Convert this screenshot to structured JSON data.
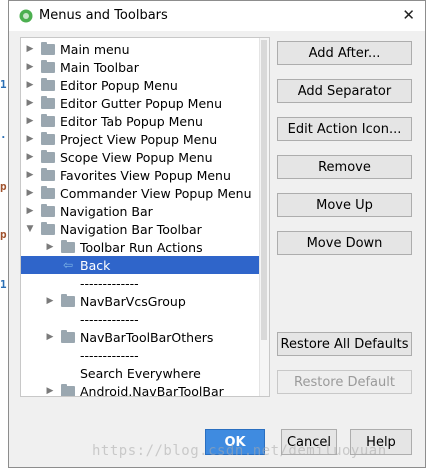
{
  "window": {
    "title": "Menus and Toolbars",
    "close_glyph": "✕"
  },
  "tree": {
    "rows": [
      {
        "label": "Main menu",
        "kind": "folder",
        "arrow": "▶",
        "level": 0
      },
      {
        "label": "Main Toolbar",
        "kind": "folder",
        "arrow": "▶",
        "level": 0
      },
      {
        "label": "Editor Popup Menu",
        "kind": "folder",
        "arrow": "▶",
        "level": 0
      },
      {
        "label": "Editor Gutter Popup Menu",
        "kind": "folder",
        "arrow": "▶",
        "level": 0
      },
      {
        "label": "Editor Tab Popup Menu",
        "kind": "folder",
        "arrow": "▶",
        "level": 0
      },
      {
        "label": "Project View Popup Menu",
        "kind": "folder",
        "arrow": "▶",
        "level": 0
      },
      {
        "label": "Scope View Popup Menu",
        "kind": "folder",
        "arrow": "▶",
        "level": 0
      },
      {
        "label": "Favorites View Popup Menu",
        "kind": "folder",
        "arrow": "▶",
        "level": 0
      },
      {
        "label": "Commander View Popup Menu",
        "kind": "folder",
        "arrow": "▶",
        "level": 0
      },
      {
        "label": "Navigation Bar",
        "kind": "folder",
        "arrow": "▶",
        "level": 0
      },
      {
        "label": "Navigation Bar Toolbar",
        "kind": "folder",
        "arrow": "▼",
        "level": 0
      },
      {
        "label": "Toolbar Run Actions",
        "kind": "folder",
        "arrow": "▶",
        "level": 1
      },
      {
        "label": "Back",
        "kind": "action",
        "arrow": "",
        "level": 1,
        "selected": true
      },
      {
        "label": "-------------",
        "kind": "separator",
        "arrow": "",
        "level": 1
      },
      {
        "label": "NavBarVcsGroup",
        "kind": "folder",
        "arrow": "▶",
        "level": 1
      },
      {
        "label": "-------------",
        "kind": "separator",
        "arrow": "",
        "level": 1
      },
      {
        "label": "NavBarToolBarOthers",
        "kind": "folder",
        "arrow": "▶",
        "level": 1
      },
      {
        "label": "-------------",
        "kind": "separator",
        "arrow": "",
        "level": 1
      },
      {
        "label": "Search Everywhere",
        "kind": "action",
        "arrow": "",
        "level": 1
      },
      {
        "label": "Android.NavBarToolBar",
        "kind": "folder",
        "arrow": "▶",
        "level": 1
      }
    ]
  },
  "buttons": {
    "add_after": "Add After...",
    "add_separator": "Add Separator",
    "edit_action_icon": "Edit Action Icon...",
    "remove": "Remove",
    "move_up": "Move Up",
    "move_down": "Move Down",
    "restore_all_defaults": "Restore All Defaults",
    "restore_default": "Restore Default"
  },
  "footer": {
    "ok": "OK",
    "cancel": "Cancel",
    "help": "Help"
  },
  "watermark": "https://blog.csdn.net/demiluoyuan",
  "colors": {
    "selection": "#2f65ca",
    "ok_button": "#3f8be0"
  }
}
